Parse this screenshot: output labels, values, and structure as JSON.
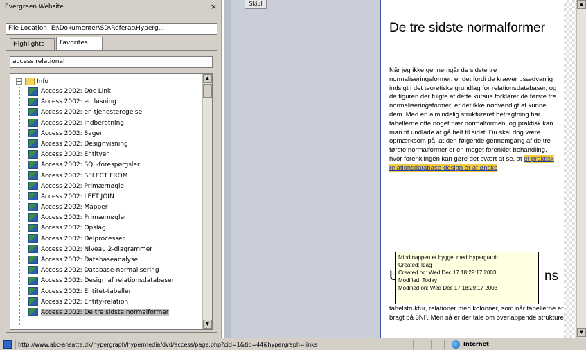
{
  "pane": {
    "title": "Evergreen Website",
    "close": "×",
    "location": "File Location: E:\\Dokumenter\\SD\\Referat\\Hyperg...",
    "tabs": [
      "Highlights",
      "Favorites"
    ],
    "search_value": "access relational",
    "root_label": "Info",
    "items": [
      "Access 2002: Doc Link",
      "Access 2002: en løsning",
      "Access 2002: en tjenesteregelse",
      "Access 2002: Indberetning",
      "Access 2002: Sager",
      "Access 2002: Designvisning",
      "Access 2002: Entityer",
      "Access 2002: SQL-forespørgsler",
      "Access 2002: SELECT FROM",
      "Access 2002: Primærnøgle",
      "Access 2002: LEFT JOIN",
      "Access 2002: Mapper",
      "Access 2002: Primærnøgler",
      "Access 2002: Opslag",
      "Access 2002: Delprocesser",
      "Access 2002: Niveau 2-diagrammer",
      "Access 2002: Databaseanalyse",
      "Access 2002: Database-normalisering",
      "Access 2002: Design af relationsdatabaser",
      "Access 2002: Entitet-tabeller",
      "Access 2002: Entity-relation",
      "Access 2002: De tre sidste normalformer"
    ],
    "selected_index": 21
  },
  "mid": {
    "button_label": "Skjul"
  },
  "content": {
    "heading": "De tre sidste normalformer",
    "paragraph_before_link": "Når jeg ikke gennemgår de sidste tre normaliseringsformer, er det fordi de kræver usædvanlig indsigt i det teoretiske grundlag for relationsdatabaser, og da figuren der fulgte af dette kursus forklarer de første tre normaliseringsformer, er det ikke nødvendigt at kunne dem. Med en almindelig struktureret betragtning har tabellerne ofte noget nær normalformen, og praktisk kan man tit undlade at gå helt til sidst. Du skal dog være opmærksom på, at den følgende gennemgang af de tre første normalformer er en meget forenklet behandling, hvor forenklingen kan gøre det svært at se, at",
    "link_text": "et praktisk relationsdatabase-design er at ønske",
    "tooltip": {
      "title": "Mindmappen er bygget med Hypergraph",
      "lines": [
        "Created: Idag",
        "Created on: Wed Dec 17 18:29:17 2003",
        "Modified: Today",
        "Modified on: Wed Dec 17 18:29:17 2003"
      ]
    },
    "heading2_start": "U",
    "heading2_end": "ns",
    "paragraph2": "tabelstruktur, relationer med kolonner, som når tabellerne er bragt på 3NF. Men så er der tale om overlappende strukturer."
  },
  "status": {
    "url": "http://www.abc-ansatte.dk/hypergraph/hypermedia/dvd/access/page.php?cid=1&tid=44&hypergraph=links",
    "zone": "Internet"
  }
}
